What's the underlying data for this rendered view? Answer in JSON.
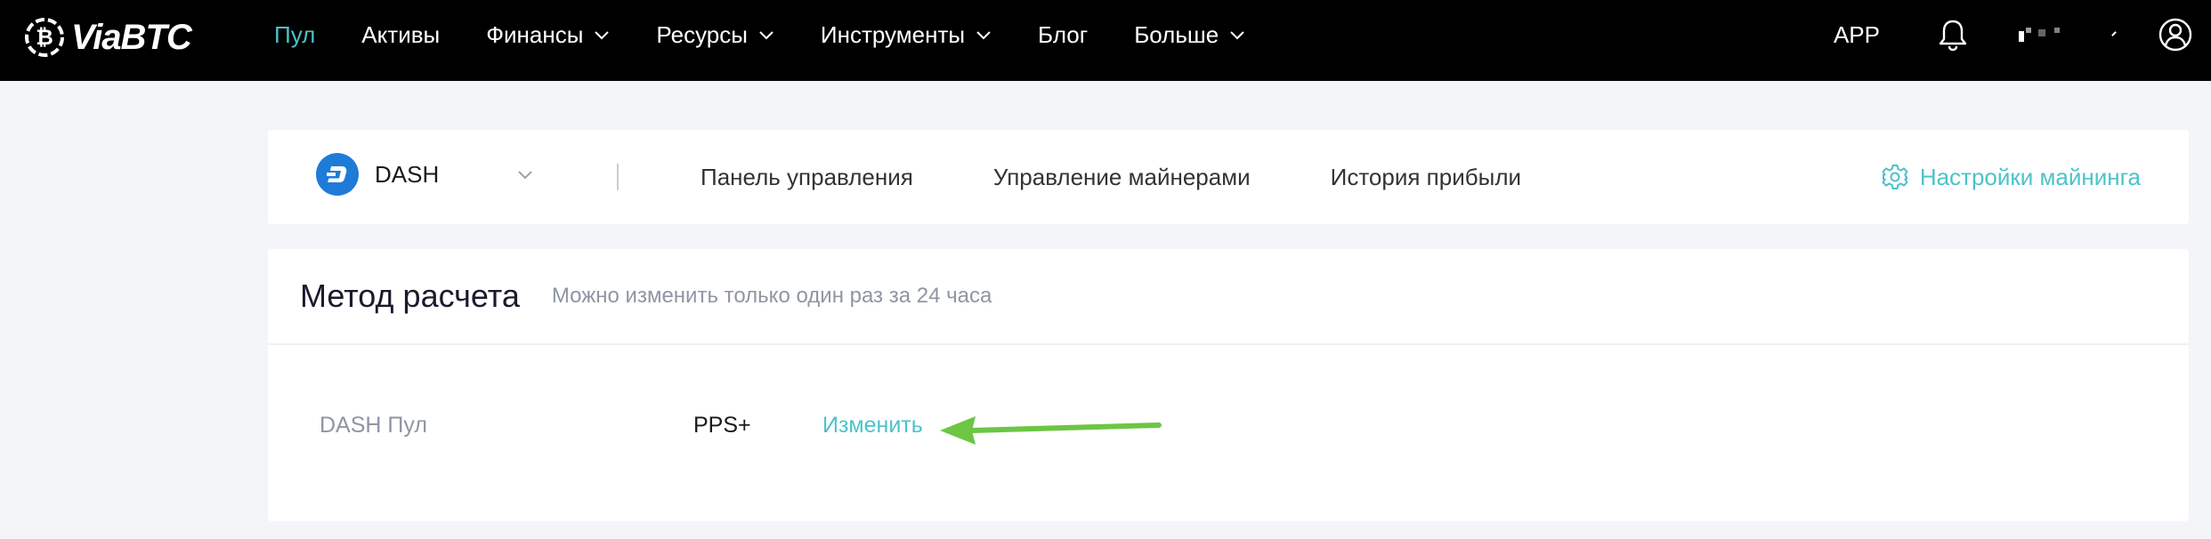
{
  "brand": {
    "logo_text": "ViaBTC",
    "accent": "#4dc2c9"
  },
  "nav": {
    "items": [
      {
        "label": "Пул",
        "active": true,
        "dropdown": false
      },
      {
        "label": "Активы",
        "active": false,
        "dropdown": false
      },
      {
        "label": "Финансы",
        "active": false,
        "dropdown": true
      },
      {
        "label": "Ресурсы",
        "active": false,
        "dropdown": true
      },
      {
        "label": "Инструменты",
        "active": false,
        "dropdown": true
      },
      {
        "label": "Блог",
        "active": false,
        "dropdown": false
      },
      {
        "label": "Больше",
        "active": false,
        "dropdown": true
      }
    ],
    "app_label": "APP"
  },
  "subbar": {
    "coin": "DASH",
    "tabs": [
      "Панель управления",
      "Управление майнерами",
      "История прибыли"
    ],
    "settings_label": "Настройки майнинга"
  },
  "settlement": {
    "title": "Метод расчета",
    "hint": "Можно изменить только один раз за 24 часа",
    "row_label": "DASH Пул",
    "method": "PPS+",
    "change_label": "Изменить"
  }
}
